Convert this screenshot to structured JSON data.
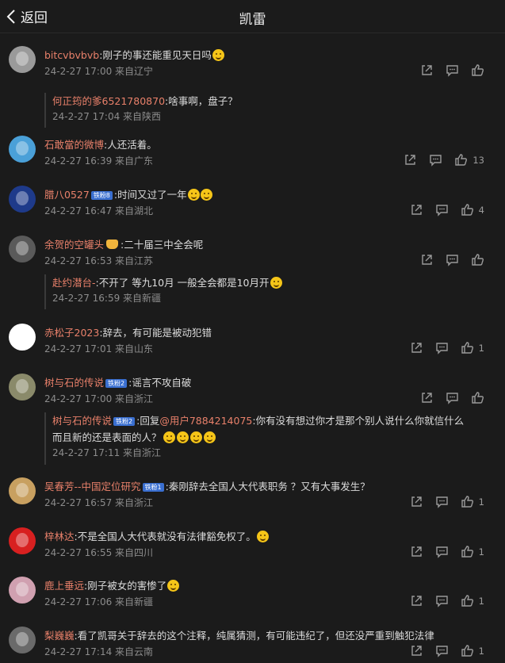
{
  "header": {
    "back_label": "返回",
    "title": "凯雷"
  },
  "comments": [
    {
      "user": "bitcvbvbvb",
      "text": ":刚子的事还能重见天日吗",
      "time": "24-2-27 17:00 来自辽宁",
      "likes": "",
      "emoji": "cat-emoji",
      "replies": [
        {
          "user": "何正筠的爹6521780870",
          "text": ":啥事啊，盘子？",
          "time": "24-2-27 17:04 来自陕西"
        }
      ]
    },
    {
      "user": "石敢當的微博",
      "text": ":人还活着。",
      "time": "24-2-27 16:39 来自广东",
      "likes": "13",
      "replies": []
    },
    {
      "user": "腊八0527",
      "badge": "铁粉8",
      "text": ":时间又过了一年",
      "time": "24-2-27 16:47 来自湖北",
      "likes": "4",
      "emoji": "smile-emoji",
      "replies": []
    },
    {
      "user": "余贺的空罐头",
      "text": ":二十届三中全会呢",
      "time": "24-2-27 16:53 来自江苏",
      "likes": "",
      "replies": [
        {
          "user": "赴约潜台-",
          "text": ":不开了  等九10月  一般全会都是10月开",
          "time": "24-2-27 16:59 来自新疆"
        }
      ]
    },
    {
      "user": "赤松子2023",
      "text": ":辞去，有可能是被动犯错",
      "time": "24-2-27 17:01 来自山东",
      "likes": "1",
      "replies": []
    },
    {
      "user": "树与石的传说",
      "badge": "铁粉2",
      "text": ":谣言不攻自破",
      "time": "24-2-27 17:00 来自浙江",
      "likes": "",
      "replies": [
        {
          "user": "树与石的传说",
          "badge": "铁粉2",
          "text_pre": ":回复",
          "mention": "@用户7884214075",
          "text": ":你有没有想过你才是那个别人说什么你就信什么",
          "text2": "而且新的还是表面的人？",
          "time": "24-2-27 17:11 来自浙江"
        }
      ]
    },
    {
      "user": "吴春芳--中国定位研究",
      "badge": "铁粉1",
      "text": ":秦刚辞去全国人大代表职务 ？又有大事发生？",
      "time": "24-2-27 16:57 来自浙江",
      "likes": "1",
      "replies": []
    },
    {
      "user": "梓林达",
      "text": ":不是全国人大代表就没有法律豁免权了。",
      "time": "24-2-27 16:55 来自四川",
      "likes": "1",
      "replies": []
    },
    {
      "user": "鹿上垂远",
      "text": ":刚子被女的害惨了",
      "time": "24-2-27 17:06 来自新疆",
      "likes": "1",
      "replies": []
    },
    {
      "user": "梨巍巍",
      "text": ":看了凯哥关于辞去的这个注释，纯属猜测，有可能违纪了，但还没严重到触犯法律",
      "time": "24-2-27 17:14 来自云南",
      "likes": "1",
      "replies": []
    }
  ],
  "colors": {
    "background": "#1b1b1b",
    "username": "#e8806a",
    "meta": "#8c8c8c",
    "badge": "#3a6fd0"
  }
}
